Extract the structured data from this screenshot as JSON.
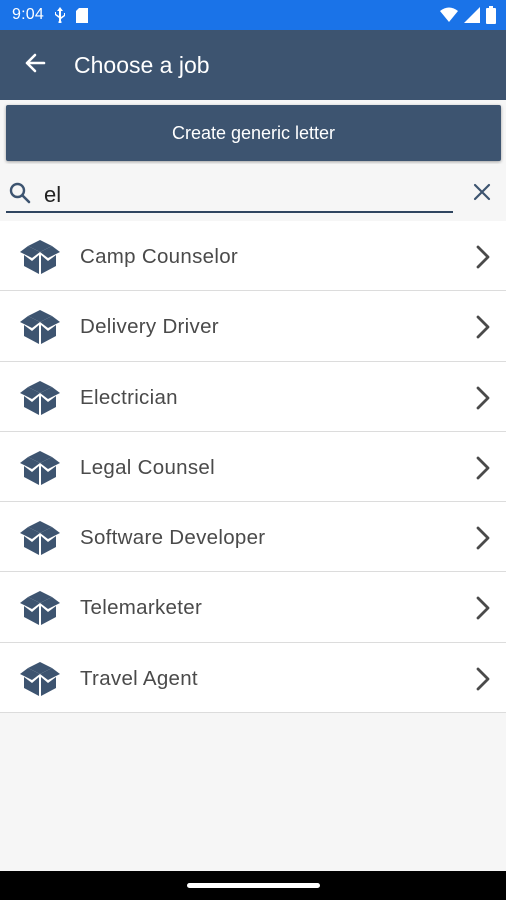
{
  "status_bar": {
    "time": "9:04",
    "left_icons": [
      "usb-icon",
      "sd-card-icon"
    ],
    "right_icons": [
      "wifi-icon",
      "signal-icon",
      "battery-icon"
    ],
    "color": "#1a73e8"
  },
  "app_bar": {
    "title": "Choose a job",
    "back_icon": "arrow-left-icon",
    "color": "#3d5470"
  },
  "generic_button": {
    "label": "Create generic letter"
  },
  "search": {
    "value": "el",
    "placeholder": "",
    "search_icon": "search-icon",
    "clear_icon": "close-icon"
  },
  "jobs": [
    {
      "label": "Camp Counselor",
      "icon": "open-box-icon"
    },
    {
      "label": "Delivery Driver",
      "icon": "open-box-icon"
    },
    {
      "label": "Electrician",
      "icon": "open-box-icon"
    },
    {
      "label": "Legal Counsel",
      "icon": "open-box-icon"
    },
    {
      "label": "Software Developer",
      "icon": "open-box-icon"
    },
    {
      "label": "Telemarketer",
      "icon": "open-box-icon"
    },
    {
      "label": "Travel Agent",
      "icon": "open-box-icon"
    }
  ]
}
